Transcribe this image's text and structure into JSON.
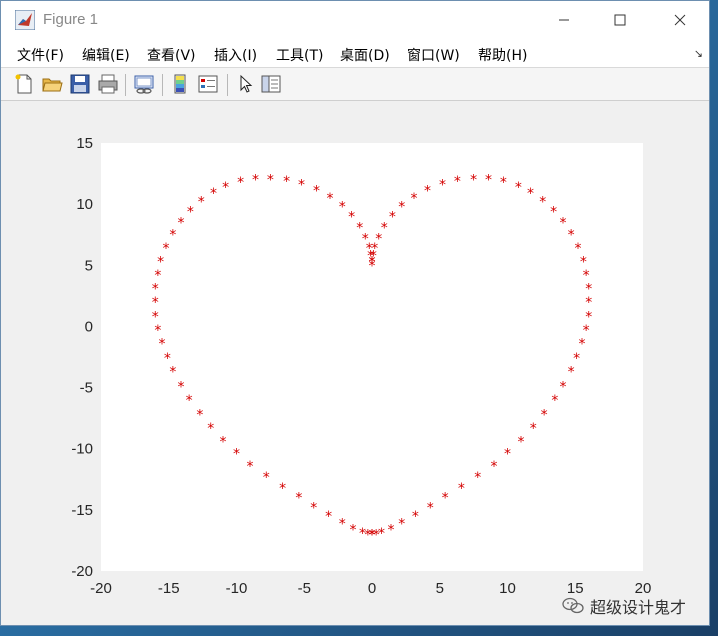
{
  "window": {
    "title": "Figure 1"
  },
  "menu": {
    "items": [
      "文件(F)",
      "编辑(E)",
      "查看(V)",
      "插入(I)",
      "工具(T)",
      "桌面(D)",
      "窗口(W)",
      "帮助(H)"
    ]
  },
  "toolbar": {
    "buttons": [
      "new-figure-icon",
      "open-file-icon",
      "save-icon",
      "print-icon",
      "link-plot-icon",
      "colorbar-icon",
      "legend-icon",
      "select-pointer-icon",
      "property-editor-icon"
    ]
  },
  "colors": {
    "marker": "#d40000",
    "axes_bg": "#ffffff",
    "figure_bg": "#f0f0f0"
  },
  "chart_data": {
    "type": "scatter",
    "marker": "*",
    "marker_color": "#d40000",
    "title": "",
    "xlabel": "",
    "ylabel": "",
    "xlim": [
      -20,
      20
    ],
    "ylim": [
      -20,
      15
    ],
    "xticks": [
      -20,
      -15,
      -10,
      -5,
      0,
      5,
      10,
      15,
      20
    ],
    "yticks": [
      -20,
      -15,
      -10,
      -5,
      0,
      5,
      10,
      15
    ],
    "grid": false,
    "legend": false,
    "x": [
      0.0,
      0.0,
      0.1,
      0.2,
      0.5,
      0.9,
      1.5,
      2.2,
      3.1,
      4.1,
      5.2,
      6.3,
      7.5,
      8.6,
      9.7,
      10.8,
      11.7,
      12.6,
      13.4,
      14.1,
      14.7,
      15.2,
      15.6,
      15.8,
      16.0,
      16.0,
      16.0,
      15.8,
      15.5,
      15.1,
      14.7,
      14.1,
      13.5,
      12.7,
      11.9,
      11.0,
      10.0,
      9.0,
      7.8,
      6.6,
      5.4,
      4.3,
      3.2,
      2.2,
      1.4,
      0.7,
      0.3,
      0.0,
      0.0,
      0.0,
      -0.3,
      -0.7,
      -1.4,
      -2.2,
      -3.2,
      -4.3,
      -5.4,
      -6.6,
      -7.8,
      -9.0,
      -10.0,
      -11.0,
      -11.9,
      -12.7,
      -13.5,
      -14.1,
      -14.7,
      -15.1,
      -15.5,
      -15.8,
      -16.0,
      -16.0,
      -16.0,
      -15.8,
      -15.6,
      -15.2,
      -14.7,
      -14.1,
      -13.4,
      -12.6,
      -11.7,
      -10.8,
      -9.7,
      -8.6,
      -7.5,
      -6.3,
      -5.2,
      -4.1,
      -3.1,
      -2.2,
      -1.5,
      -0.9,
      -0.5,
      -0.2,
      -0.1,
      0.0
    ],
    "y": [
      5.0,
      5.3,
      5.8,
      6.4,
      7.2,
      8.1,
      9.0,
      9.8,
      10.5,
      11.1,
      11.6,
      11.9,
      12.0,
      12.0,
      11.8,
      11.4,
      10.9,
      10.2,
      9.4,
      8.5,
      7.5,
      6.4,
      5.3,
      4.2,
      3.1,
      2.0,
      0.8,
      -0.3,
      -1.4,
      -2.6,
      -3.7,
      -4.9,
      -6.0,
      -7.2,
      -8.3,
      -9.4,
      -10.4,
      -11.4,
      -12.3,
      -13.2,
      -14.0,
      -14.8,
      -15.5,
      -16.1,
      -16.6,
      -16.9,
      -17.0,
      -17.0,
      -17.0,
      -17.0,
      -17.0,
      -16.9,
      -16.6,
      -16.1,
      -15.5,
      -14.8,
      -14.0,
      -13.2,
      -12.3,
      -11.4,
      -10.4,
      -9.4,
      -8.3,
      -7.2,
      -6.0,
      -4.9,
      -3.7,
      -2.6,
      -1.4,
      -0.3,
      0.8,
      2.0,
      3.1,
      4.2,
      5.3,
      6.4,
      7.5,
      8.5,
      9.4,
      10.2,
      10.9,
      11.4,
      11.8,
      12.0,
      12.0,
      11.9,
      11.6,
      11.1,
      10.5,
      9.8,
      9.0,
      8.1,
      7.2,
      6.4,
      5.8,
      5.3
    ]
  },
  "watermark": {
    "text": "超级设计鬼才"
  }
}
